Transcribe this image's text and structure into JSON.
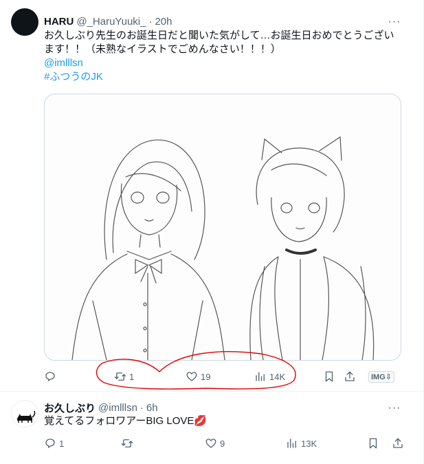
{
  "tweet1": {
    "name": "HARU",
    "handle": "@_HaruYuuki_",
    "dot": "·",
    "time": "20h",
    "text_line1": "お久しぶり先生のお誕生日だと聞いた気がして…お誕生日おめでとうござい",
    "text_line2": "ます！！（未熟なイラストでごめんなさい！！！）",
    "mention": "@imlllsn",
    "hashtag": "#ふつうのJK",
    "more": "···",
    "stats": {
      "replies": "",
      "retweets": "1",
      "likes": "19",
      "views": "14K",
      "img_badge": "IMG⇩"
    }
  },
  "tweet2": {
    "name": "お久しぶり",
    "handle": "@imlllsn",
    "dot": "·",
    "time": "6h",
    "text": "覚えてるフォロワアーBIG LOVE💋",
    "more": "···",
    "stats": {
      "replies": "1",
      "retweets": "",
      "likes": "9",
      "views": "13K"
    }
  },
  "icons": [
    "reply-icon",
    "retweet-icon",
    "like-icon",
    "views-icon",
    "bookmark-icon",
    "share-icon",
    "more-icon"
  ],
  "colors": {
    "link": "#1d9bf0",
    "secondary_text": "#536471",
    "annotation_stroke": "#e00000"
  }
}
